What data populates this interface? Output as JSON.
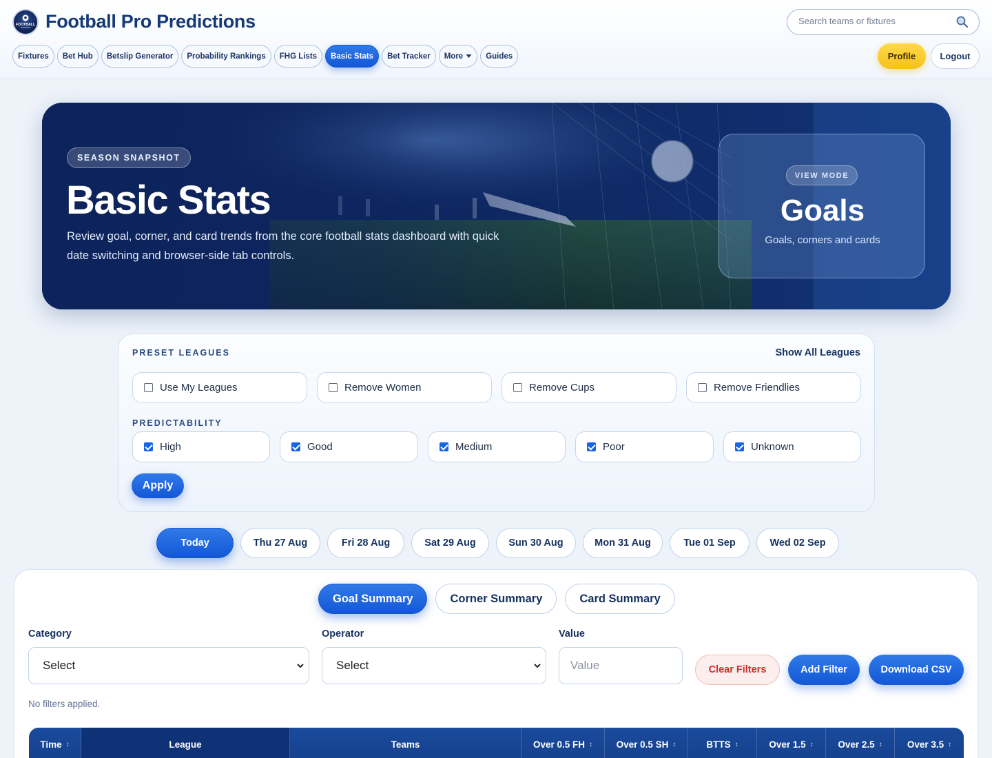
{
  "header": {
    "brand": "Football Pro Predictions",
    "logo_text": "FOOTBALL",
    "search_placeholder": "Search teams or fixtures",
    "nav": [
      {
        "label": "Fixtures",
        "active": false
      },
      {
        "label": "Bet Hub",
        "active": false
      },
      {
        "label": "Betslip Generator",
        "active": false
      },
      {
        "label": "Probability Rankings",
        "active": false
      },
      {
        "label": "FHG Lists",
        "active": false
      },
      {
        "label": "Basic Stats",
        "active": true
      },
      {
        "label": "Bet Tracker",
        "active": false
      },
      {
        "label": "More",
        "active": false
      },
      {
        "label": "Guides",
        "active": false
      }
    ],
    "profile_label": "Profile",
    "logout_label": "Logout"
  },
  "hero": {
    "chip": "SEASON SNAPSHOT",
    "title": "Basic Stats",
    "description": "Review goal, corner, and card trends from the core football stats dashboard with quick date switching and browser-side tab controls.",
    "view_mode_chip": "VIEW MODE",
    "view_mode_value": "Goals",
    "view_mode_sub": "Goals, corners and cards"
  },
  "filters": {
    "preset_label": "PRESET LEAGUES",
    "show_all": "Show All Leagues",
    "preset_options": [
      {
        "label": "Use My Leagues",
        "checked": false
      },
      {
        "label": "Remove Women",
        "checked": false
      },
      {
        "label": "Remove Cups",
        "checked": false
      },
      {
        "label": "Remove Friendlies",
        "checked": false
      }
    ],
    "predictability_label": "PREDICTABILITY",
    "predictability_options": [
      {
        "label": "High",
        "checked": true
      },
      {
        "label": "Good",
        "checked": true
      },
      {
        "label": "Medium",
        "checked": true
      },
      {
        "label": "Poor",
        "checked": true
      },
      {
        "label": "Unknown",
        "checked": true
      }
    ],
    "apply_label": "Apply"
  },
  "dates": [
    {
      "label": "Today",
      "active": true
    },
    {
      "label": "Thu 27 Aug",
      "active": false
    },
    {
      "label": "Fri 28 Aug",
      "active": false
    },
    {
      "label": "Sat 29 Aug",
      "active": false
    },
    {
      "label": "Sun 30 Aug",
      "active": false
    },
    {
      "label": "Mon 31 Aug",
      "active": false
    },
    {
      "label": "Tue 01 Sep",
      "active": false
    },
    {
      "label": "Wed 02 Sep",
      "active": false
    }
  ],
  "summary_tabs": [
    {
      "label": "Goal Summary",
      "active": true
    },
    {
      "label": "Corner Summary",
      "active": false
    },
    {
      "label": "Card Summary",
      "active": false
    }
  ],
  "filter_builder": {
    "category_label": "Category",
    "category_value": "Select",
    "operator_label": "Operator",
    "operator_value": "Select",
    "value_label": "Value",
    "value_placeholder": "Value",
    "clear_label": "Clear Filters",
    "add_label": "Add Filter",
    "download_label": "Download CSV",
    "status": "No filters applied."
  },
  "table": {
    "columns": [
      "Time",
      "League",
      "Teams",
      "Over 0.5 FH",
      "Over 0.5 SH",
      "BTTS",
      "Over 1.5",
      "Over 2.5",
      "Over 3.5"
    ],
    "sort_glyph": "↕"
  },
  "colors": {
    "accent": "#1457d6",
    "brand": "#163a78",
    "profile": "#f6c21a",
    "danger": "#d42a2a"
  }
}
